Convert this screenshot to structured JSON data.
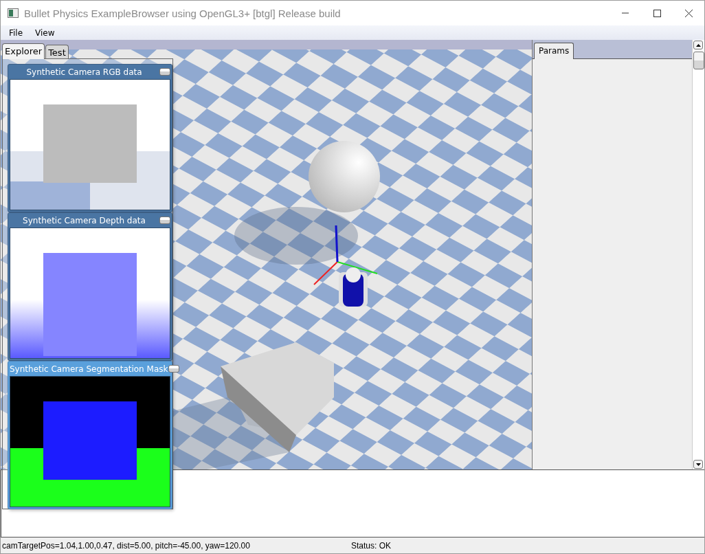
{
  "window": {
    "title": "Bullet Physics ExampleBrowser using OpenGL3+ [btgl] Release build"
  },
  "menu": [
    "File",
    "View"
  ],
  "left_tabs": [
    {
      "label": "Explorer",
      "selected": true
    },
    {
      "label": "Test",
      "selected": false
    }
  ],
  "camera_windows": [
    {
      "title": "Synthetic Camera RGB data",
      "kind": "rgb",
      "selected": false
    },
    {
      "title": "Synthetic Camera Depth data",
      "kind": "depth",
      "selected": false
    },
    {
      "title": "Synthetic Camera Segmentation Mask",
      "kind": "segmentation",
      "selected": true
    }
  ],
  "right_tabs": [
    {
      "label": "Params",
      "selected": true
    }
  ],
  "status_bar": {
    "camera": "camTargetPos=1.04,1.00,0.47, dist=5.00, pitch=-45.00, yaw=120.00",
    "status": "Status: OK"
  }
}
